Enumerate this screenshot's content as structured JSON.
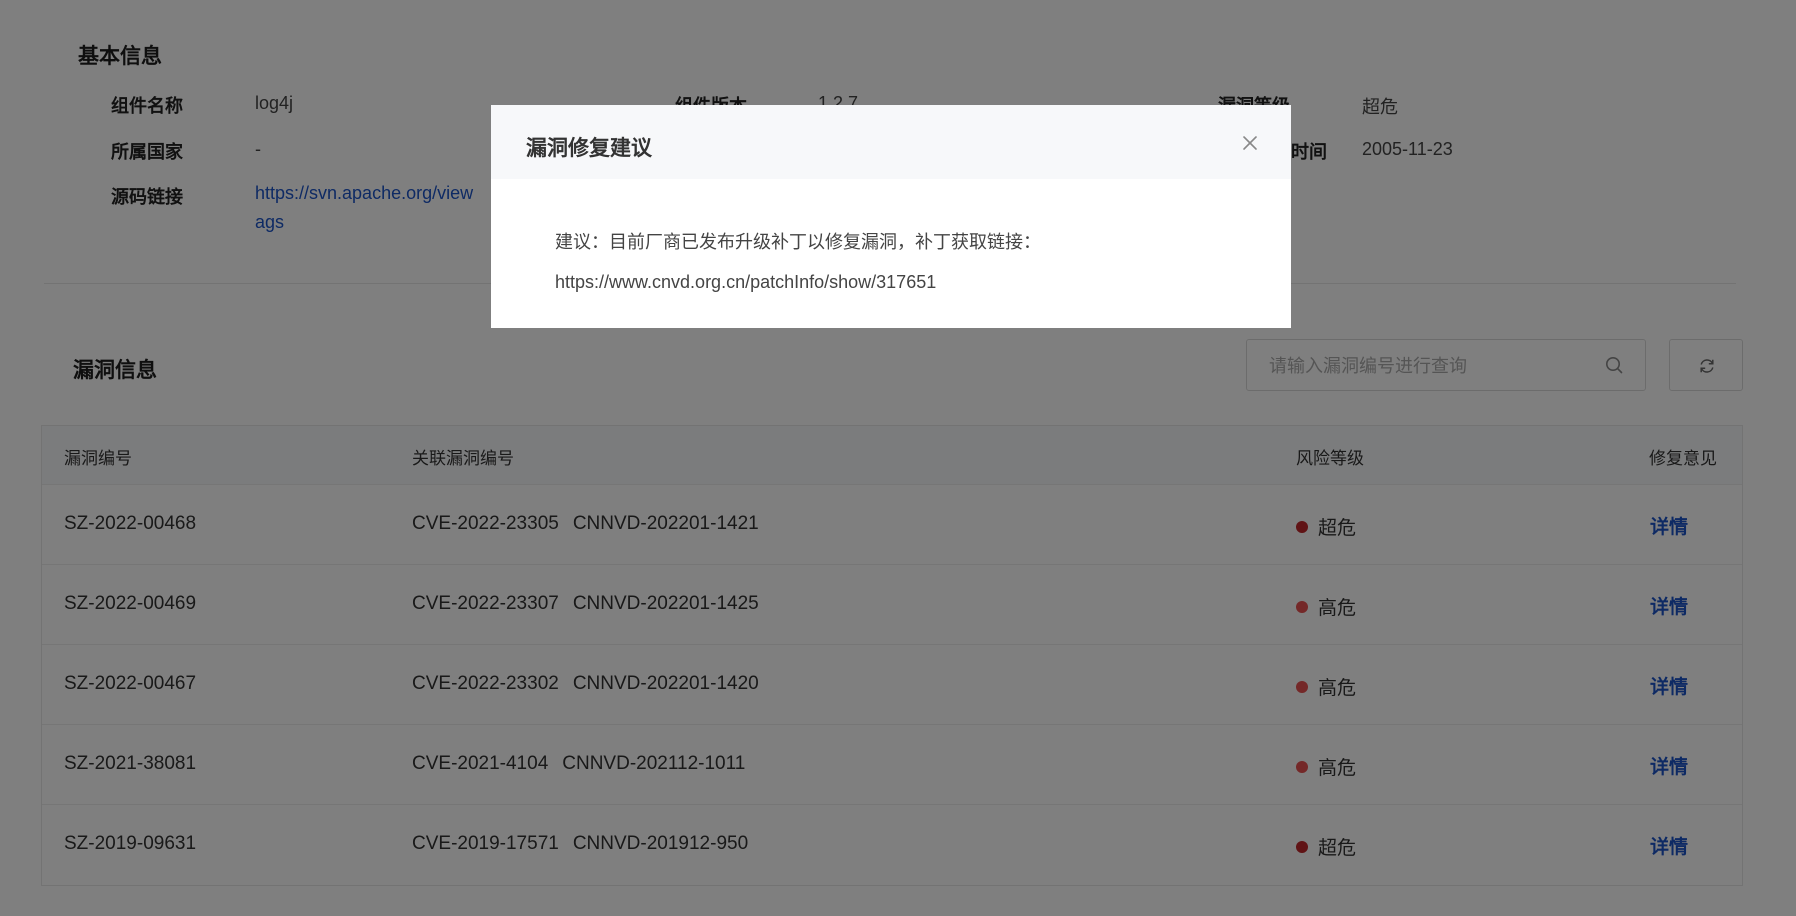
{
  "basic_info": {
    "title": "基本信息",
    "fields": [
      {
        "label": "组件名称",
        "value": "log4j"
      },
      {
        "label": "组件版本",
        "value": "1.2.7"
      },
      {
        "label": "漏洞等级",
        "value": "超危"
      },
      {
        "label": "所属国家",
        "value": "-"
      },
      {
        "label": "时间",
        "value": "2005-11-23"
      },
      {
        "label": "源码链接",
        "value": "https://svn.apache.org/view",
        "value2": "ags"
      }
    ]
  },
  "vuln_section": {
    "title": "漏洞信息",
    "search_placeholder": "请输入漏洞编号进行查询",
    "search_icon": "search-icon",
    "refresh_icon": "refresh-icon"
  },
  "table": {
    "headers": [
      "漏洞编号",
      "关联漏洞编号",
      "风险等级",
      "修复意见"
    ],
    "rows": [
      {
        "id": "SZ-2022-00468",
        "cve": "CVE-2022-23305",
        "cnnvd": "CNNVD-202201-1421",
        "risk": "超危",
        "risk_color": "#c0272b",
        "action": "详情"
      },
      {
        "id": "SZ-2022-00469",
        "cve": "CVE-2022-23307",
        "cnnvd": "CNNVD-202201-1425",
        "risk": "高危",
        "risk_color": "#e85050",
        "action": "详情"
      },
      {
        "id": "SZ-2022-00467",
        "cve": "CVE-2022-23302",
        "cnnvd": "CNNVD-202201-1420",
        "risk": "高危",
        "risk_color": "#e85050",
        "action": "详情"
      },
      {
        "id": "SZ-2021-38081",
        "cve": "CVE-2021-4104",
        "cnnvd": "CNNVD-202112-1011",
        "risk": "高危",
        "risk_color": "#e85050",
        "action": "详情"
      },
      {
        "id": "SZ-2019-09631",
        "cve": "CVE-2019-17571",
        "cnnvd": "CNNVD-201912-950",
        "risk": "超危",
        "risk_color": "#c0272b",
        "action": "详情"
      }
    ]
  },
  "modal": {
    "title": "漏洞修复建议",
    "close_icon": "close-icon",
    "suggestion": "建议：目前厂商已发布升级补丁以修复漏洞，补丁获取链接：",
    "link": "https://www.cnvd.org.cn/patchInfo/show/317651"
  },
  "colors": {
    "link": "#1c55c9",
    "overlay": "rgba(0,0,0,0.5)",
    "critical": "#c0272b",
    "high": "#e85050"
  }
}
